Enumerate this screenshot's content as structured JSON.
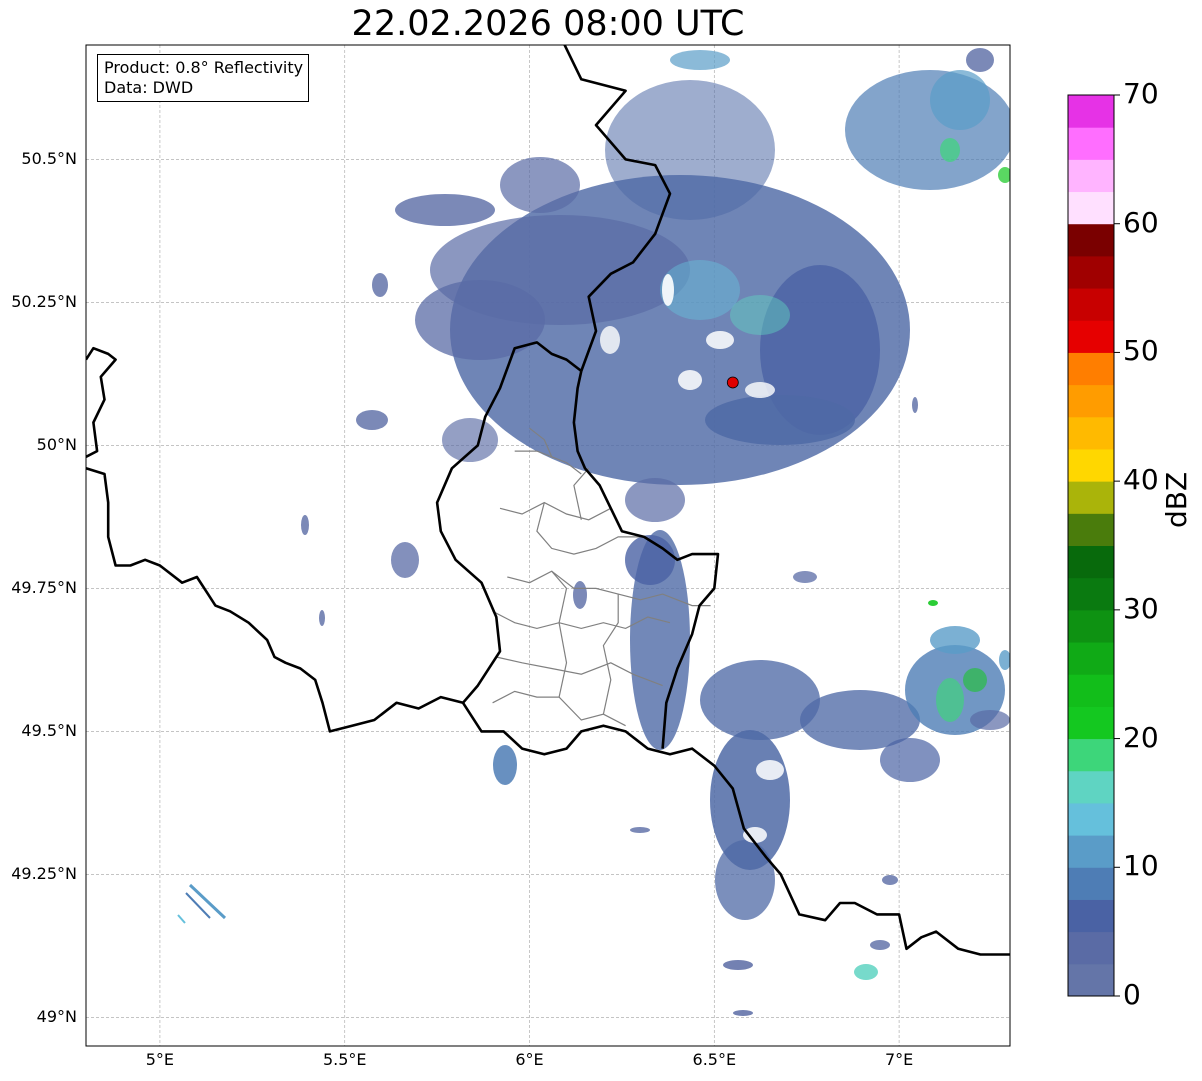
{
  "title": "22.02.2026 08:00 UTC",
  "info": {
    "product": "Product: 0.8° Reflectivity",
    "source": "Data: DWD"
  },
  "map_extent": {
    "lon_min": 4.8,
    "lon_max": 7.3,
    "lat_min": 48.95,
    "lat_max": 50.7
  },
  "lat_ticks": [
    {
      "value": 50.5,
      "label": "50.5°N"
    },
    {
      "value": 50.25,
      "label": "50.25°N"
    },
    {
      "value": 50.0,
      "label": "50°N"
    },
    {
      "value": 49.75,
      "label": "49.75°N"
    },
    {
      "value": 49.5,
      "label": "49.5°N"
    },
    {
      "value": 49.25,
      "label": "49.25°N"
    },
    {
      "value": 49.0,
      "label": "49°N"
    }
  ],
  "lon_ticks": [
    {
      "value": 5.0,
      "label": "5°E"
    },
    {
      "value": 5.5,
      "label": "5.5°E"
    },
    {
      "value": 6.0,
      "label": "6°E"
    },
    {
      "value": 6.5,
      "label": "6.5°E"
    },
    {
      "value": 7.0,
      "label": "7°E"
    }
  ],
  "radar_site": {
    "lon": 6.55,
    "lat": 50.11,
    "color": "#e00000"
  },
  "colorbar": {
    "unit": "dBZ",
    "min": 0,
    "max": 70,
    "step": 2.5,
    "labels": [
      {
        "value": 0,
        "text": "0"
      },
      {
        "value": 10,
        "text": "10"
      },
      {
        "value": 20,
        "text": "20"
      },
      {
        "value": 30,
        "text": "30"
      },
      {
        "value": 40,
        "text": "40"
      },
      {
        "value": 50,
        "text": "50"
      },
      {
        "value": 60,
        "text": "60"
      },
      {
        "value": 70,
        "text": "70"
      }
    ],
    "colors": [
      "#6475a8",
      "#5a6ba5",
      "#4a62a4",
      "#4e7db5",
      "#5a9cc8",
      "#65c0dc",
      "#5fd4c2",
      "#3dd67a",
      "#14c820",
      "#12be1a",
      "#10aa16",
      "#0e9212",
      "#0a7a10",
      "#086a0c",
      "#4a7c0c",
      "#aab40a",
      "#ffd700",
      "#ffba00",
      "#ff9c00",
      "#ff7e00",
      "#e60000",
      "#c80000",
      "#a00000",
      "#7a0000",
      "#ffe0ff",
      "#ffb4ff",
      "#ff6eff",
      "#e632e6"
    ]
  },
  "borders": {
    "national": [
      [
        [
          4.8,
          50.15
        ],
        [
          4.82,
          50.17
        ],
        [
          4.86,
          50.16
        ],
        [
          4.88,
          50.15
        ],
        [
          4.84,
          50.12
        ],
        [
          4.85,
          50.08
        ],
        [
          4.82,
          50.04
        ],
        [
          4.83,
          49.99
        ],
        [
          4.8,
          49.98
        ]
      ],
      [
        [
          4.8,
          49.96
        ],
        [
          4.85,
          49.95
        ],
        [
          4.86,
          49.9
        ],
        [
          4.86,
          49.84
        ],
        [
          4.88,
          49.79
        ],
        [
          4.92,
          49.79
        ],
        [
          4.96,
          49.8
        ],
        [
          5.0,
          49.79
        ],
        [
          5.06,
          49.76
        ],
        [
          5.1,
          49.77
        ],
        [
          5.13,
          49.74
        ],
        [
          5.15,
          49.72
        ],
        [
          5.19,
          49.71
        ],
        [
          5.24,
          49.69
        ],
        [
          5.29,
          49.66
        ],
        [
          5.31,
          49.63
        ],
        [
          5.34,
          49.62
        ],
        [
          5.38,
          49.61
        ],
        [
          5.42,
          49.59
        ],
        [
          5.44,
          49.55
        ],
        [
          5.46,
          49.5
        ],
        [
          5.52,
          49.51
        ],
        [
          5.58,
          49.52
        ],
        [
          5.64,
          49.55
        ],
        [
          5.7,
          49.54
        ],
        [
          5.76,
          49.56
        ],
        [
          5.82,
          49.55
        ],
        [
          5.87,
          49.5
        ],
        [
          5.93,
          49.5
        ],
        [
          5.98,
          49.47
        ],
        [
          6.04,
          49.46
        ],
        [
          6.1,
          49.47
        ],
        [
          6.14,
          49.5
        ],
        [
          6.2,
          49.51
        ],
        [
          6.26,
          49.5
        ],
        [
          6.32,
          49.47
        ],
        [
          6.38,
          49.46
        ],
        [
          6.44,
          49.47
        ],
        [
          6.5,
          49.44
        ],
        [
          6.55,
          49.4
        ],
        [
          6.58,
          49.33
        ],
        [
          6.64,
          49.28
        ],
        [
          6.68,
          49.25
        ],
        [
          6.73,
          49.18
        ],
        [
          6.8,
          49.17
        ],
        [
          6.84,
          49.2
        ],
        [
          6.88,
          49.2
        ],
        [
          6.94,
          49.18
        ],
        [
          7.0,
          49.18
        ],
        [
          7.02,
          49.12
        ],
        [
          7.06,
          49.14
        ],
        [
          7.1,
          49.15
        ],
        [
          7.16,
          49.12
        ],
        [
          7.22,
          49.11
        ],
        [
          7.3,
          49.11
        ]
      ]
    ],
    "luxembourg_germany": [
      [
        6.14,
        50.13
      ],
      [
        6.13,
        50.1
      ],
      [
        6.12,
        50.04
      ],
      [
        6.13,
        49.99
      ],
      [
        6.15,
        49.96
      ],
      [
        6.19,
        49.93
      ],
      [
        6.22,
        49.89
      ],
      [
        6.25,
        49.85
      ],
      [
        6.31,
        49.84
      ],
      [
        6.36,
        49.82
      ],
      [
        6.4,
        49.8
      ],
      [
        6.44,
        49.81
      ],
      [
        6.51,
        49.81
      ],
      [
        6.5,
        49.75
      ],
      [
        6.46,
        49.72
      ],
      [
        6.44,
        49.67
      ],
      [
        6.4,
        49.61
      ],
      [
        6.37,
        49.55
      ],
      [
        6.36,
        49.47
      ]
    ],
    "luxembourg_belgium": [
      [
        5.82,
        49.55
      ],
      [
        5.86,
        49.58
      ],
      [
        5.92,
        49.64
      ],
      [
        5.91,
        49.7
      ],
      [
        5.87,
        49.76
      ],
      [
        5.8,
        49.8
      ],
      [
        5.76,
        49.85
      ],
      [
        5.75,
        49.9
      ],
      [
        5.79,
        49.96
      ],
      [
        5.86,
        50.0
      ],
      [
        5.88,
        50.05
      ],
      [
        5.92,
        50.1
      ],
      [
        5.96,
        50.17
      ],
      [
        6.02,
        50.18
      ],
      [
        6.06,
        50.16
      ],
      [
        6.1,
        50.15
      ],
      [
        6.14,
        50.13
      ]
    ],
    "belgium_germany": [
      [
        6.14,
        50.13
      ],
      [
        6.18,
        50.2
      ],
      [
        6.16,
        50.26
      ],
      [
        6.22,
        50.3
      ],
      [
        6.28,
        50.32
      ],
      [
        6.34,
        50.37
      ],
      [
        6.38,
        50.44
      ],
      [
        6.34,
        50.49
      ],
      [
        6.26,
        50.5
      ],
      [
        6.18,
        50.56
      ],
      [
        6.26,
        50.62
      ],
      [
        6.14,
        50.64
      ],
      [
        6.08,
        50.72
      ]
    ],
    "cantons": [
      [
        [
          5.92,
          49.89
        ],
        [
          5.98,
          49.88
        ],
        [
          6.04,
          49.9
        ],
        [
          6.1,
          49.88
        ],
        [
          6.16,
          49.87
        ],
        [
          6.22,
          49.89
        ]
      ],
      [
        [
          5.96,
          49.99
        ],
        [
          6.02,
          49.99
        ],
        [
          6.06,
          49.98
        ],
        [
          6.1,
          49.97
        ],
        [
          6.14,
          49.95
        ]
      ],
      [
        [
          6.0,
          50.03
        ],
        [
          6.04,
          50.01
        ],
        [
          6.06,
          49.98
        ]
      ],
      [
        [
          6.04,
          49.9
        ],
        [
          6.02,
          49.85
        ],
        [
          6.06,
          49.82
        ],
        [
          6.12,
          49.81
        ],
        [
          6.18,
          49.82
        ],
        [
          6.24,
          49.84
        ],
        [
          6.3,
          49.84
        ]
      ],
      [
        [
          5.94,
          49.77
        ],
        [
          6.0,
          49.76
        ],
        [
          6.06,
          49.78
        ],
        [
          6.12,
          49.75
        ],
        [
          6.18,
          49.75
        ],
        [
          6.24,
          49.74
        ],
        [
          6.3,
          49.73
        ],
        [
          6.36,
          49.74
        ],
        [
          6.44,
          49.72
        ],
        [
          6.49,
          49.72
        ]
      ],
      [
        [
          5.9,
          49.71
        ],
        [
          5.96,
          49.69
        ],
        [
          6.02,
          49.68
        ],
        [
          6.08,
          49.69
        ],
        [
          6.14,
          49.68
        ],
        [
          6.2,
          49.69
        ],
        [
          6.26,
          49.68
        ],
        [
          6.32,
          49.7
        ],
        [
          6.38,
          49.69
        ]
      ],
      [
        [
          5.91,
          49.63
        ],
        [
          5.98,
          49.62
        ],
        [
          6.06,
          49.61
        ],
        [
          6.14,
          49.6
        ],
        [
          6.22,
          49.62
        ],
        [
          6.28,
          49.6
        ],
        [
          6.36,
          49.58
        ]
      ],
      [
        [
          5.9,
          49.55
        ],
        [
          5.96,
          49.57
        ],
        [
          6.02,
          49.56
        ],
        [
          6.08,
          49.56
        ],
        [
          6.14,
          49.52
        ],
        [
          6.2,
          49.53
        ],
        [
          6.26,
          49.51
        ]
      ],
      [
        [
          6.08,
          49.56
        ],
        [
          6.1,
          49.62
        ],
        [
          6.08,
          49.69
        ],
        [
          6.1,
          49.75
        ],
        [
          6.06,
          49.78
        ]
      ],
      [
        [
          6.2,
          49.53
        ],
        [
          6.22,
          49.59
        ],
        [
          6.2,
          49.65
        ],
        [
          6.24,
          49.69
        ],
        [
          6.24,
          49.74
        ]
      ],
      [
        [
          6.14,
          49.87
        ],
        [
          6.12,
          49.93
        ],
        [
          6.16,
          49.96
        ]
      ]
    ]
  }
}
